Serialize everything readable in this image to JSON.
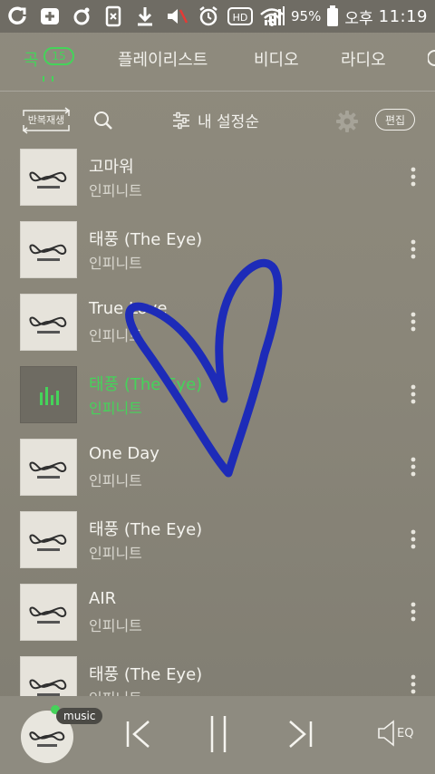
{
  "status_bar": {
    "battery": "95%",
    "ampm": "오후",
    "time": "11:19",
    "hd": "HD"
  },
  "tabs": [
    {
      "label": "곡",
      "badge": "15"
    },
    {
      "label": "플레이리스트"
    },
    {
      "label": "비디오"
    },
    {
      "label": "라디오"
    }
  ],
  "toolbar": {
    "repeat_label": "반복재생",
    "sort_label": "내 설정순",
    "edit_label": "편집"
  },
  "songs": [
    {
      "title": "고마워",
      "artist": "인피니트"
    },
    {
      "title": "태풍 (The Eye)",
      "artist": "인피니트"
    },
    {
      "title": "True Love",
      "artist": "인피니트"
    },
    {
      "title": "태풍 (The Eye)",
      "artist": "인피니트"
    },
    {
      "title": "One Day",
      "artist": "인피니트"
    },
    {
      "title": "태풍 (The Eye)",
      "artist": "인피니트"
    },
    {
      "title": "AIR",
      "artist": "인피니트"
    },
    {
      "title": "태풍 (The Eye)",
      "artist": "인피니트"
    }
  ],
  "player": {
    "service_label": "music",
    "eq_label": "EQ"
  },
  "colors": {
    "accent": "#45d35a",
    "drawing": "#1d2bb8"
  }
}
